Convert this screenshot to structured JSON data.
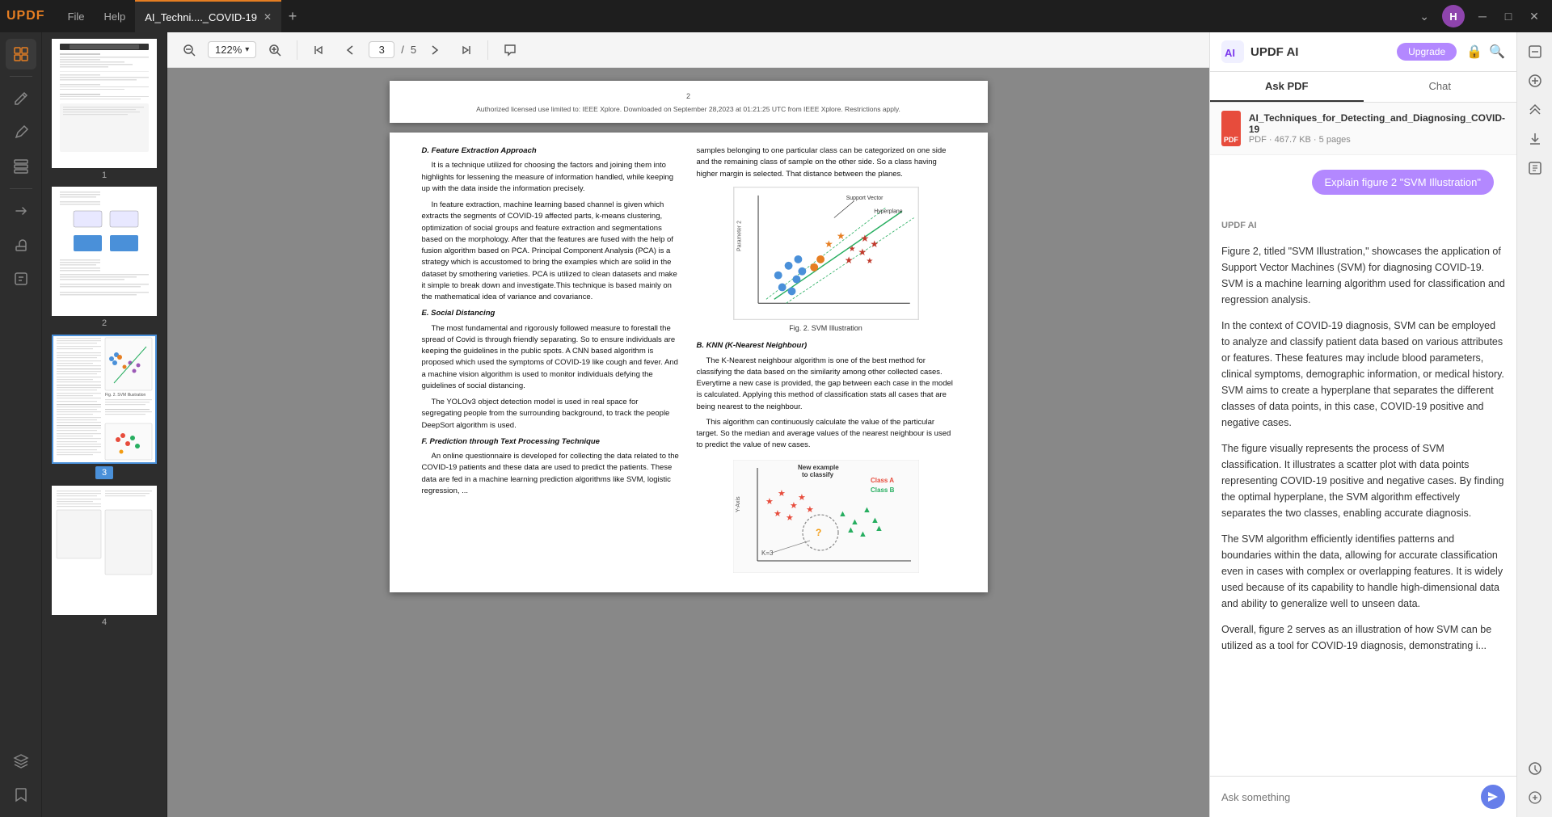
{
  "app": {
    "logo": "UPDF",
    "tabs": [
      {
        "label": "File",
        "active": false
      },
      {
        "label": "Help",
        "active": false
      },
      {
        "label": "AI_Techni...._COVID-19",
        "active": true
      }
    ],
    "user_initial": "H",
    "window_controls": [
      "minimize",
      "maximize",
      "close"
    ]
  },
  "left_sidebar": {
    "icons": [
      {
        "name": "layout-icon",
        "symbol": "⊞",
        "active": true
      },
      {
        "name": "edit-icon",
        "symbol": "✏",
        "active": false
      },
      {
        "name": "annotate-icon",
        "symbol": "🖊",
        "active": false
      },
      {
        "name": "organize-icon",
        "symbol": "⊟",
        "active": false
      },
      {
        "name": "convert-icon",
        "symbol": "⇄",
        "active": false
      },
      {
        "name": "stamp-icon",
        "symbol": "◈",
        "active": false
      },
      {
        "name": "ocr-icon",
        "symbol": "⊡",
        "active": false
      },
      {
        "name": "layers-icon",
        "symbol": "≡",
        "active": false
      },
      {
        "name": "bookmark-icon",
        "symbol": "🔖",
        "active": false
      }
    ]
  },
  "toolbar": {
    "zoom_out_label": "−",
    "zoom_in_label": "+",
    "zoom_value": "122%",
    "zoom_dropdown": "▾",
    "page_first_label": "⇈",
    "page_prev_label": "↑",
    "page_current": "3",
    "page_sep": "/",
    "page_total": "5",
    "page_next_label": "↓",
    "page_last_label": "⇊",
    "comment_label": "💬"
  },
  "thumbnails": [
    {
      "number": "1",
      "active": false
    },
    {
      "number": "2",
      "active": false
    },
    {
      "number": "3",
      "active": true
    },
    {
      "number": "4",
      "active": false
    }
  ],
  "pdf": {
    "header_text": "Authorized licensed use limited to: IEEE Xplore. Downloaded on September 28,2023 at 01:21:25 UTC from IEEE Xplore.  Restrictions apply.",
    "page_number": "2",
    "left_col": {
      "section_d": "D.  Feature Extraction Approach",
      "para1": "It is a technique utilized for choosing the factors and joining them into highlights for lessening the measure of information handled, while keeping up with the data inside the information precisely.",
      "para2": "In feature extraction, machine learning based channel is given which extracts the segments of  COVID-19 affected parts, k-means clustering, optimization of social groups and feature extraction and segmentations based on the morphology. After that the features are fused with the help of fusion algorithm based on PCA. Principal Component Analysis (PCA) is a strategy which is accustomed to bring the examples which are solid in the dataset by smothering varieties. PCA is utilized to clean datasets and make it simple to break down and investigate.This technique is based mainly on the mathematical idea of variance and covariance.",
      "section_e": "E.  Social Distancing",
      "para3": "The most fundamental and rigorously followed measure to forestall the spread of Covid is through friendly separating. So to ensure individuals are keeping the guidelines in the public spots. A CNN based algorithm is proposed which used the symptoms of COVID-19 like cough and fever. And a machine vision algorithm is used to monitor individuals defying the guidelines of social distancing.",
      "para4": "The YOLOv3 object detection model is used in real space for segregating people from the surrounding background, to track the people DeepSort algorithm is used.",
      "section_f": "F.  Prediction through Text Processing Technique",
      "para5": "An online questionnaire is developed for collecting the data related to the COVID-19 patients and these data are used to predict the patients. These data are fed in a machine learning prediction algorithms like SVM, logistic regression, ..."
    },
    "right_col": {
      "intro": "samples belonging to one particular class can be categorized on one side and the remaining class of sample on the other side. So a class having higher margin is selected. That distance between the planes.",
      "figure_caption": "Fig. 2.  SVM Illustration",
      "section_b": "B.  KNN (K-Nearest Neighbour)",
      "para_b1": "The K-Nearest neighbour algorithm is one of the best method for classifying the data based on the similarity among other collected cases. Everytime a new case is provided, the gap between each case in the model is calculated. Applying this method of classification stats all cases that are being nearest to the neighbour.",
      "para_b2": "This algorithm can continuously calculate the value of the particular target. So the median and average values of the nearest neighbour is used to predict the value of new cases."
    }
  },
  "ai_panel": {
    "title": "UPDF AI",
    "upgrade_label": "Upgrade",
    "tabs": [
      "Ask PDF",
      "Chat"
    ],
    "active_tab": "Ask PDF",
    "file_name": "AI_Techniques_for_Detecting_and_Diagnosing_COVID-19",
    "file_type": "PDF",
    "file_size": "467.7 KB",
    "file_pages": "5 pages",
    "explain_btn": "Explain figure 2 \"SVM Illustration\"",
    "sender": "UPDF AI",
    "messages": [
      {
        "text": "Figure 2, titled \"SVM Illustration,\" showcases the application of Support Vector Machines (SVM) for diagnosing COVID-19. SVM is a machine learning algorithm used for classification and regression analysis."
      },
      {
        "text": "In the context of COVID-19 diagnosis, SVM can be employed to analyze and classify patient data based on various attributes or features. These features may include blood parameters, clinical symptoms, demographic information, or medical history. SVM aims to create a hyperplane that separates the different classes of data points, in this case, COVID-19 positive and negative cases."
      },
      {
        "text": "The figure visually represents the process of SVM classification. It illustrates a scatter plot with data points representing COVID-19 positive and negative cases. By finding the optimal hyperplane, the SVM algorithm effectively separates the two classes, enabling accurate diagnosis."
      },
      {
        "text": "The SVM algorithm efficiently identifies patterns and boundaries within the data, allowing for accurate classification even in cases with complex or overlapping features. It is widely used because of its capability to handle high-dimensional data and ability to generalize well to unseen data."
      },
      {
        "text": "Overall, figure 2 serves as an illustration of how SVM can be utilized as a tool for COVID-19 diagnosis, demonstrating i..."
      }
    ],
    "input_placeholder": "Ask something"
  }
}
